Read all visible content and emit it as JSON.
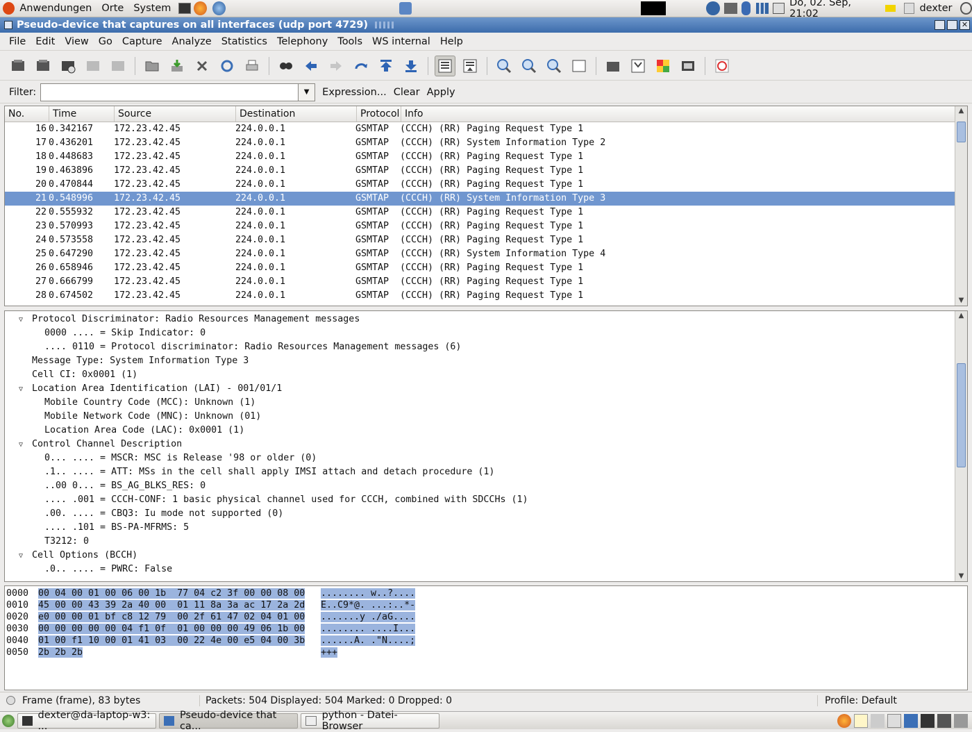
{
  "topbar": {
    "menu_apps": "Anwendungen",
    "menu_places": "Orte",
    "menu_system": "System",
    "clock": "Do, 02. Sep, 21:02",
    "user": "dexter"
  },
  "window": {
    "title": "Pseudo-device that captures on all interfaces (udp port 4729)"
  },
  "menu": [
    "File",
    "Edit",
    "View",
    "Go",
    "Capture",
    "Analyze",
    "Statistics",
    "Telephony",
    "Tools",
    "WS internal",
    "Help"
  ],
  "filter": {
    "label": "Filter:",
    "value": "",
    "expression": "Expression...",
    "clear": "Clear",
    "apply": "Apply"
  },
  "packet_list": {
    "columns": [
      "No.",
      "Time",
      "Source",
      "Destination",
      "Protocol",
      "Info"
    ],
    "rows": [
      {
        "no": "16",
        "time": "0.342167",
        "src": "172.23.42.45",
        "dst": "224.0.0.1",
        "proto": "GSMTAP",
        "info": "(CCCH) (RR) Paging Request Type 1"
      },
      {
        "no": "17",
        "time": "0.436201",
        "src": "172.23.42.45",
        "dst": "224.0.0.1",
        "proto": "GSMTAP",
        "info": "(CCCH) (RR) System Information Type 2"
      },
      {
        "no": "18",
        "time": "0.448683",
        "src": "172.23.42.45",
        "dst": "224.0.0.1",
        "proto": "GSMTAP",
        "info": "(CCCH) (RR) Paging Request Type 1"
      },
      {
        "no": "19",
        "time": "0.463896",
        "src": "172.23.42.45",
        "dst": "224.0.0.1",
        "proto": "GSMTAP",
        "info": "(CCCH) (RR) Paging Request Type 1"
      },
      {
        "no": "20",
        "time": "0.470844",
        "src": "172.23.42.45",
        "dst": "224.0.0.1",
        "proto": "GSMTAP",
        "info": "(CCCH) (RR) Paging Request Type 1"
      },
      {
        "no": "21",
        "time": "0.548996",
        "src": "172.23.42.45",
        "dst": "224.0.0.1",
        "proto": "GSMTAP",
        "info": "(CCCH) (RR) System Information Type 3",
        "selected": true
      },
      {
        "no": "22",
        "time": "0.555932",
        "src": "172.23.42.45",
        "dst": "224.0.0.1",
        "proto": "GSMTAP",
        "info": "(CCCH) (RR) Paging Request Type 1"
      },
      {
        "no": "23",
        "time": "0.570993",
        "src": "172.23.42.45",
        "dst": "224.0.0.1",
        "proto": "GSMTAP",
        "info": "(CCCH) (RR) Paging Request Type 1"
      },
      {
        "no": "24",
        "time": "0.573558",
        "src": "172.23.42.45",
        "dst": "224.0.0.1",
        "proto": "GSMTAP",
        "info": "(CCCH) (RR) Paging Request Type 1"
      },
      {
        "no": "25",
        "time": "0.647290",
        "src": "172.23.42.45",
        "dst": "224.0.0.1",
        "proto": "GSMTAP",
        "info": "(CCCH) (RR) System Information Type 4"
      },
      {
        "no": "26",
        "time": "0.658946",
        "src": "172.23.42.45",
        "dst": "224.0.0.1",
        "proto": "GSMTAP",
        "info": "(CCCH) (RR) Paging Request Type 1"
      },
      {
        "no": "27",
        "time": "0.666799",
        "src": "172.23.42.45",
        "dst": "224.0.0.1",
        "proto": "GSMTAP",
        "info": "(CCCH) (RR) Paging Request Type 1"
      },
      {
        "no": "28",
        "time": "0.674502",
        "src": "172.23.42.45",
        "dst": "224.0.0.1",
        "proto": "GSMTAP",
        "info": "(CCCH) (RR) Paging Request Type 1"
      }
    ]
  },
  "details": [
    {
      "level": 0,
      "expander": "open",
      "text": "Protocol Discriminator: Radio Resources Management messages"
    },
    {
      "level": 1,
      "text": "0000 .... = Skip Indicator: 0"
    },
    {
      "level": 1,
      "text": ".... 0110 = Protocol discriminator: Radio Resources Management messages (6)"
    },
    {
      "level": 0,
      "text": "Message Type: System Information Type 3"
    },
    {
      "level": 0,
      "text": "Cell CI: 0x0001 (1)"
    },
    {
      "level": 0,
      "expander": "open",
      "text": "Location Area Identification (LAI) - 001/01/1"
    },
    {
      "level": 1,
      "text": "Mobile Country Code (MCC): Unknown (1)"
    },
    {
      "level": 1,
      "text": "Mobile Network Code (MNC): Unknown (01)"
    },
    {
      "level": 1,
      "text": "Location Area Code (LAC): 0x0001 (1)"
    },
    {
      "level": 0,
      "expander": "open",
      "text": "Control Channel Description"
    },
    {
      "level": 1,
      "text": "0... .... = MSCR: MSC is Release '98 or older (0)"
    },
    {
      "level": 1,
      "text": ".1.. .... = ATT: MSs in the cell shall apply IMSI attach and detach procedure (1)"
    },
    {
      "level": 1,
      "text": "..00 0... = BS_AG_BLKS_RES: 0"
    },
    {
      "level": 1,
      "text": ".... .001 = CCCH-CONF: 1 basic physical channel used for CCCH, combined with SDCCHs (1)"
    },
    {
      "level": 1,
      "text": ".00. .... = CBQ3: Iu mode not supported (0)"
    },
    {
      "level": 1,
      "text": ".... .101 = BS-PA-MFRMS: 5"
    },
    {
      "level": 1,
      "text": "T3212: 0"
    },
    {
      "level": 0,
      "expander": "open",
      "text": "Cell Options (BCCH)"
    },
    {
      "level": 1,
      "text": ".0.. .... = PWRC: False"
    }
  ],
  "hex": [
    {
      "offset": "0000",
      "bytes": "00 04 00 01 00 06 00 1b  77 04 c2 3f 00 00 08 00",
      "ascii": "........ w..?...."
    },
    {
      "offset": "0010",
      "bytes": "45 00 00 43 39 2a 40 00  01 11 8a 3a ac 17 2a 2d",
      "ascii": "E..C9*@. ...:..*-"
    },
    {
      "offset": "0020",
      "bytes": "e0 00 00 01 bf c8 12 79  00 2f 61 47 02 04 01 00",
      "ascii": ".......y ./aG...."
    },
    {
      "offset": "0030",
      "bytes": "00 00 00 00 00 04 f1 0f  01 00 00 00 49 06 1b 00",
      "ascii": "........ ....I..."
    },
    {
      "offset": "0040",
      "bytes": "01 00 f1 10 00 01 41 03  00 22 4e 00 e5 04 00 3b",
      "ascii": "......A. .\"N....;"
    },
    {
      "offset": "0050",
      "bytes": "2b 2b 2b",
      "ascii": "+++"
    }
  ],
  "status": {
    "frame": "Frame (frame), 83 bytes",
    "packets": "Packets: 504 Displayed: 504 Marked: 0 Dropped: 0",
    "profile": "Profile: Default"
  },
  "taskbar": [
    "dexter@da-laptop-w3: ...",
    "Pseudo-device that ca...",
    "python - Datei-Browser"
  ]
}
